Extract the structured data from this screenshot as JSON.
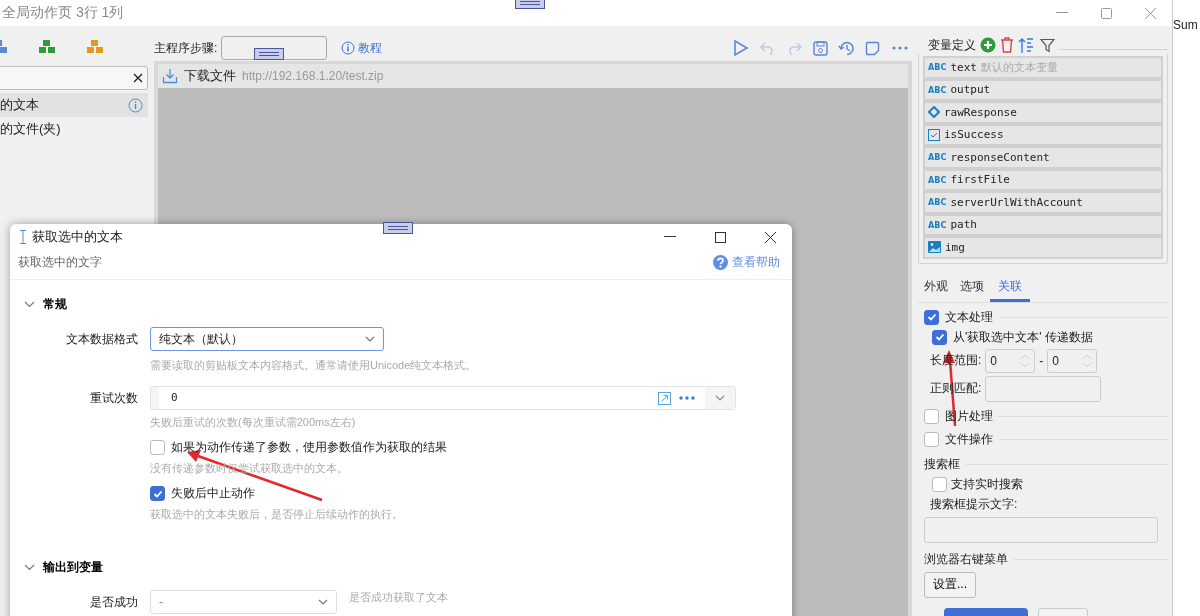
{
  "main_window": {
    "title": "全局动作页 3行 1列"
  },
  "left_panel": {
    "items": [
      {
        "label": "的文本",
        "selected": true,
        "info": true
      },
      {
        "label": "的文件(夹)",
        "selected": false,
        "info": false
      }
    ]
  },
  "step_bar": {
    "label": "主程序步骤:",
    "tutorial": "教程"
  },
  "steps": [
    {
      "name": "下载文件",
      "detail": "http://192.168.1.20/test.zip"
    }
  ],
  "variables": {
    "title": "变量定义",
    "items": [
      {
        "kind": "text",
        "type_label": "ABC",
        "name": "text",
        "note": "默认的文本变量"
      },
      {
        "kind": "text",
        "type_label": "ABC",
        "name": "output"
      },
      {
        "kind": "object",
        "name": "rawResponse"
      },
      {
        "kind": "bool",
        "name": "isSuccess"
      },
      {
        "kind": "text",
        "type_label": "ABC",
        "name": "responseContent"
      },
      {
        "kind": "text",
        "type_label": "ABC",
        "name": "firstFile"
      },
      {
        "kind": "text",
        "type_label": "ABC",
        "name": "serverUrlWithAccount"
      },
      {
        "kind": "text",
        "type_label": "ABC",
        "name": "path"
      },
      {
        "kind": "image",
        "name": "img"
      }
    ]
  },
  "props_tabs": [
    {
      "label": "外观",
      "selected": false
    },
    {
      "label": "选项",
      "selected": false
    },
    {
      "label": "关联",
      "selected": true
    }
  ],
  "relations": {
    "text_processing": {
      "label": "文本处理",
      "checked": true
    },
    "pass_data": {
      "label": "从'获取选中文本' 传递数据",
      "checked": true
    },
    "length_label": "长度范围:",
    "length_min": "0",
    "separator": "-",
    "length_max": "0",
    "regex_label": "正则匹配:",
    "image_processing": {
      "label": "图片处理",
      "checked": false
    },
    "file_ops": {
      "label": "文件操作",
      "checked": false
    },
    "search_group": "搜索框",
    "realtime": {
      "label": "支持实时搜索",
      "checked": false
    },
    "hint_label": "搜索框提示文字:",
    "context_menu": "浏览器右键菜单",
    "settings_button": "设置..."
  },
  "side_window": {
    "text": "Sum"
  },
  "dialog": {
    "title": "获取选中的文本",
    "subtitle": "获取选中的文字",
    "help": "查看帮助",
    "sections": [
      {
        "title": "常规",
        "expanded": true,
        "rows": [
          {
            "kind": "select",
            "label": "文本数据格式",
            "value": "纯文本（默认）",
            "focused": true,
            "hint": "需要读取的剪贴板文本内容格式。通常请使用Unicode纯文本格式。"
          },
          {
            "kind": "input",
            "label": "重试次数",
            "value": "0",
            "hint": "失败后重试的次数(每次重试需200ms左右)"
          },
          {
            "kind": "checkbox",
            "label": "如果为动作传递了参数，使用参数值作为获取的结果",
            "checked": false,
            "hint": "没有传递参数时仅尝试获取选中的文本。"
          },
          {
            "kind": "checkbox",
            "label": "失败后中止动作",
            "checked": true,
            "hint": "获取选中的文本失败后，是否停止后续动作的执行。"
          }
        ]
      },
      {
        "title": "输出到变量",
        "expanded": true,
        "rows": [
          {
            "kind": "select",
            "label": "是否成功",
            "value": "-",
            "focused": false,
            "side_hint": "是否成功获取了文本"
          }
        ]
      }
    ]
  }
}
